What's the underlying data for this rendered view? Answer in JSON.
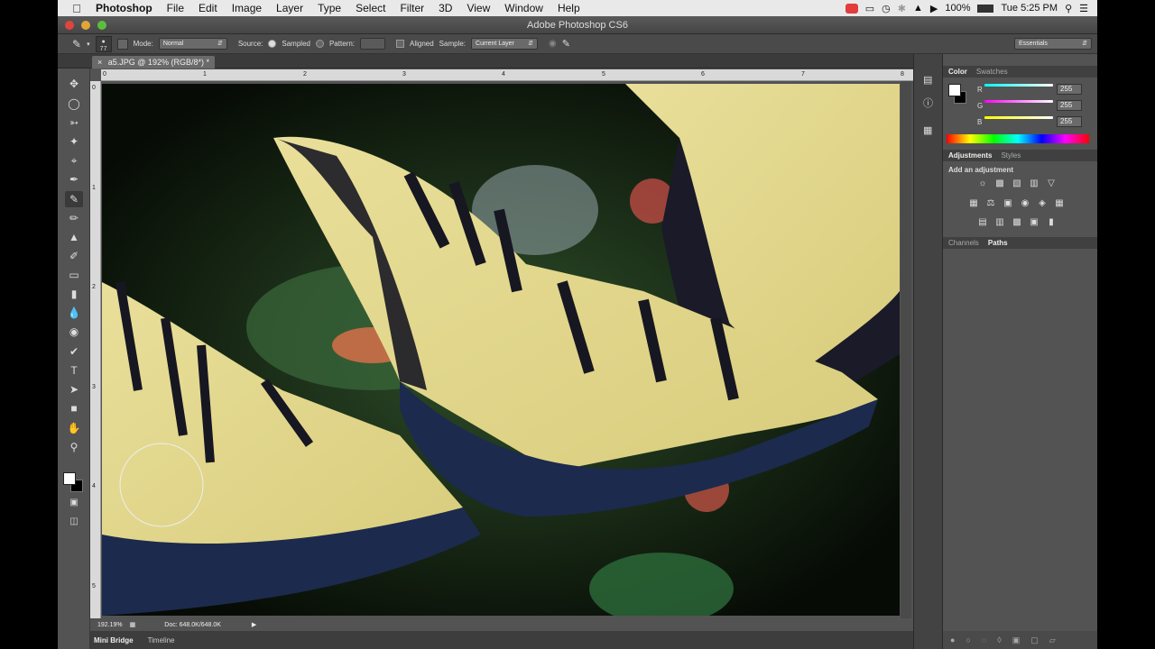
{
  "menubar": {
    "app_name": "Photoshop",
    "items": [
      "File",
      "Edit",
      "Image",
      "Layer",
      "Type",
      "Select",
      "Filter",
      "3D",
      "View",
      "Window",
      "Help"
    ],
    "battery": "100%",
    "clock": "Tue 5:25 PM"
  },
  "window": {
    "title": "Adobe Photoshop CS6"
  },
  "options": {
    "brush_size": "77",
    "mode_label": "Mode:",
    "mode_value": "Normal",
    "source_label": "Source:",
    "sampled_label": "Sampled",
    "pattern_label": "Pattern:",
    "aligned_label": "Aligned",
    "sample_label": "Sample:",
    "sample_value": "Current Layer",
    "workspace": "Essentials"
  },
  "document": {
    "tab_title": "a5.JPG @ 192% (RGB/8*) *"
  },
  "rulers": {
    "h": [
      "0",
      "1",
      "2",
      "3",
      "4",
      "5",
      "6",
      "7",
      "8"
    ],
    "v": [
      "0",
      "1",
      "2",
      "3",
      "4",
      "5"
    ]
  },
  "status": {
    "zoom": "192.19%",
    "doc": "Doc: 648.0K/648.0K"
  },
  "bottom_tabs": [
    "Mini Bridge",
    "Timeline"
  ],
  "color_panel": {
    "tabs": [
      "Color",
      "Swatches"
    ],
    "channels": [
      {
        "label": "R",
        "value": "255",
        "color": "#3fd0d4"
      },
      {
        "label": "G",
        "value": "255",
        "color": "#e05be0"
      },
      {
        "label": "B",
        "value": "255",
        "color": "#e8e84a"
      }
    ]
  },
  "adjustments_panel": {
    "tabs": [
      "Adjustments",
      "Styles"
    ],
    "heading": "Add an adjustment"
  },
  "paths_panel": {
    "tabs": [
      "Channels",
      "Paths"
    ]
  },
  "colors": {
    "foreground": "#ffffff",
    "background": "#000000",
    "ui_gray": "#535353"
  }
}
